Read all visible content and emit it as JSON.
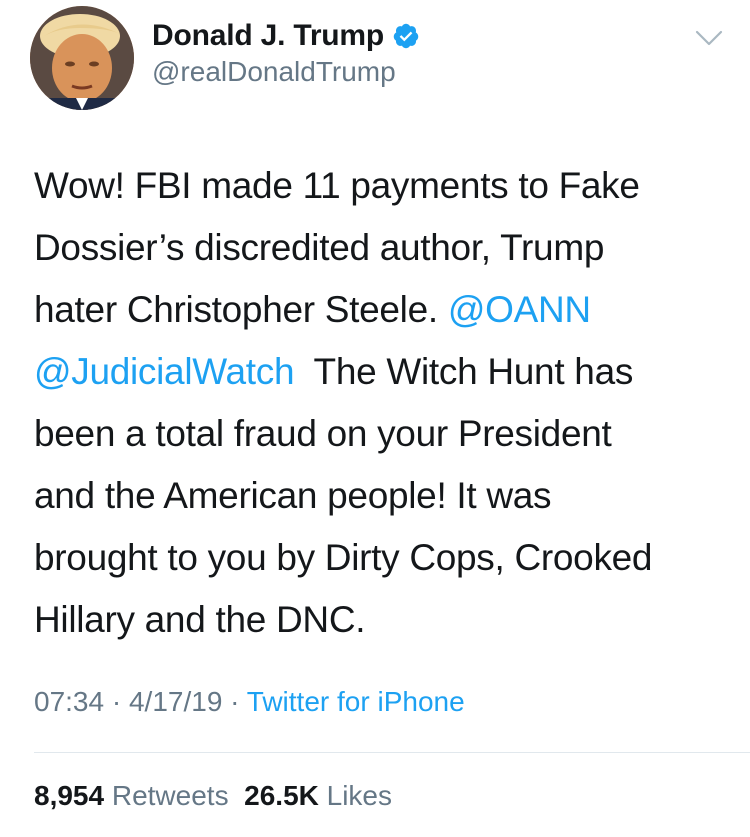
{
  "author": {
    "display_name": "Donald J. Trump",
    "handle": "@realDonaldTrump",
    "verified": true
  },
  "tweet": {
    "line1": "Wow! FBI made 11 payments to Fake",
    "line2": "Dossier’s discredited author, Trump",
    "line3_text": "hater Christopher Steele. ",
    "mention1": "@OANN",
    "mention2": "@JudicialWatch",
    "line4_text": "  The Witch Hunt has",
    "line5": "been a total fraud on your President",
    "line6": "and the American people! It was",
    "line7": "brought to you by Dirty Cops, Crooked",
    "line8": "Hillary and the DNC."
  },
  "meta": {
    "time": "07:34",
    "sep1": " · ",
    "date": "4/17/19",
    "sep2": " · ",
    "source": "Twitter for iPhone"
  },
  "stats": {
    "retweets_count": "8,954",
    "retweets_label": "Retweets",
    "likes_count": "26.5K",
    "likes_label": "Likes"
  },
  "icons": {
    "verified": "verified-badge-icon",
    "caret": "chevron-down-icon"
  },
  "colors": {
    "link": "#1da1f2",
    "secondary": "#657786",
    "text": "#14171a",
    "divider": "#e1e8ed"
  }
}
